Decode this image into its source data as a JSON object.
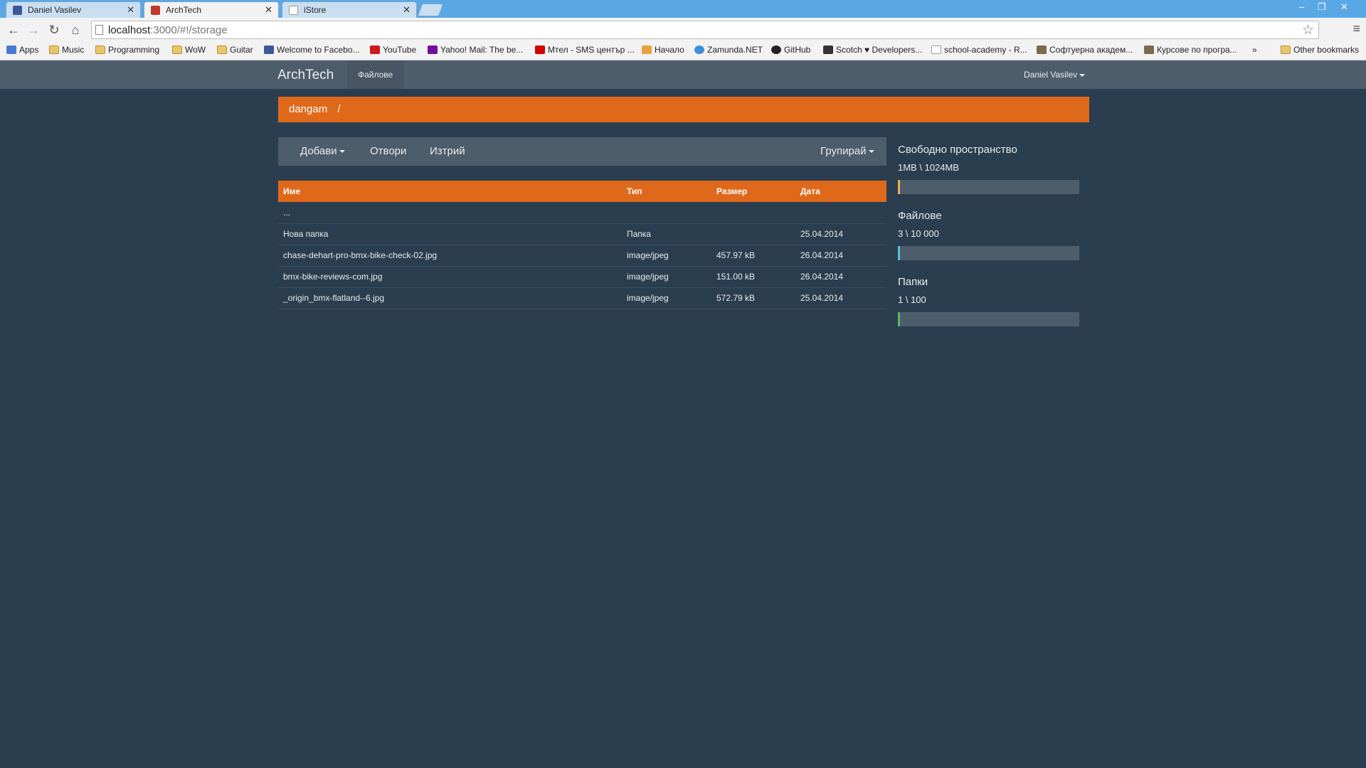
{
  "browser": {
    "tabs": [
      {
        "title": "Daniel Vasilev",
        "favicon_color": "#3b5998"
      },
      {
        "title": "ArchTech",
        "favicon_color": "#c0392b"
      },
      {
        "title": "iStore",
        "favicon_color": "#dddddd"
      }
    ],
    "url_host": "localhost",
    "url_path": ":3000/#!/storage",
    "bookmarks": [
      {
        "label": "Apps",
        "icon_color": "#4a7bd1"
      },
      {
        "label": "Music",
        "icon_color": "#e9c46a"
      },
      {
        "label": "Programming",
        "icon_color": "#e9c46a"
      },
      {
        "label": "WoW",
        "icon_color": "#e9c46a"
      },
      {
        "label": "Guitar",
        "icon_color": "#e9c46a"
      },
      {
        "label": "Welcome to Facebo...",
        "icon_color": "#3b5998"
      },
      {
        "label": "YouTube",
        "icon_color": "#cc181e"
      },
      {
        "label": "Yahoo! Mail: The be...",
        "icon_color": "#720e9e"
      },
      {
        "label": "Mтел - SMS център ...",
        "icon_color": "#d40000"
      },
      {
        "label": "Начало",
        "icon_color": "#e8a33d"
      },
      {
        "label": "Zamunda.NET",
        "icon_color": "#3a8fd8"
      },
      {
        "label": "GitHub",
        "icon_color": "#222222"
      },
      {
        "label": "Scotch ♥ Developers...",
        "icon_color": "#333333"
      },
      {
        "label": "school-academy - R...",
        "icon_color": "#ffffff"
      },
      {
        "label": "Софтуерна академ...",
        "icon_color": "#7a6a4f"
      },
      {
        "label": "Курсове по програ...",
        "icon_color": "#7a6a4f"
      }
    ],
    "overflow_label": "»",
    "other_bookmarks": "Other bookmarks"
  },
  "navbar": {
    "brand": "ArchTech",
    "files_link": "Файлове",
    "user": "Daniel Vasilev"
  },
  "breadcrumb": {
    "folder": "dangam",
    "separator": "/"
  },
  "actions": {
    "add": "Добави",
    "open": "Отвори",
    "delete": "Изтрий",
    "group": "Групирай"
  },
  "table": {
    "headers": {
      "name": "Име",
      "type": "Тип",
      "size": "Размер",
      "date": "Дата"
    },
    "rows": [
      {
        "name": "...",
        "type": "",
        "size": "",
        "date": ""
      },
      {
        "name": "Нова папка",
        "type": "Папка",
        "size": "",
        "date": "25.04.2014"
      },
      {
        "name": "chase-dehart-pro-bmx-bike-check-02.jpg",
        "type": "image/jpeg",
        "size": "457.97 kB",
        "date": "26.04.2014"
      },
      {
        "name": "bmx-bike-reviews-com.jpg",
        "type": "image/jpeg",
        "size": "151.00 kB",
        "date": "26.04.2014"
      },
      {
        "name": "_origin_bmx-flatland--6.jpg",
        "type": "image/jpeg",
        "size": "572.79 kB",
        "date": "25.04.2014"
      }
    ]
  },
  "sidebar": {
    "stats": [
      {
        "title": "Свободно пространство",
        "value": "1MB \\ 1024MB",
        "fraction": 0.001,
        "color": "#f0ad4e"
      },
      {
        "title": "Файлове",
        "value": "3 \\ 10 000",
        "fraction": 0.0003,
        "color": "#5bc0de"
      },
      {
        "title": "Папки",
        "value": "1 \\ 100",
        "fraction": 0.01,
        "color": "#5cb85c"
      }
    ]
  }
}
